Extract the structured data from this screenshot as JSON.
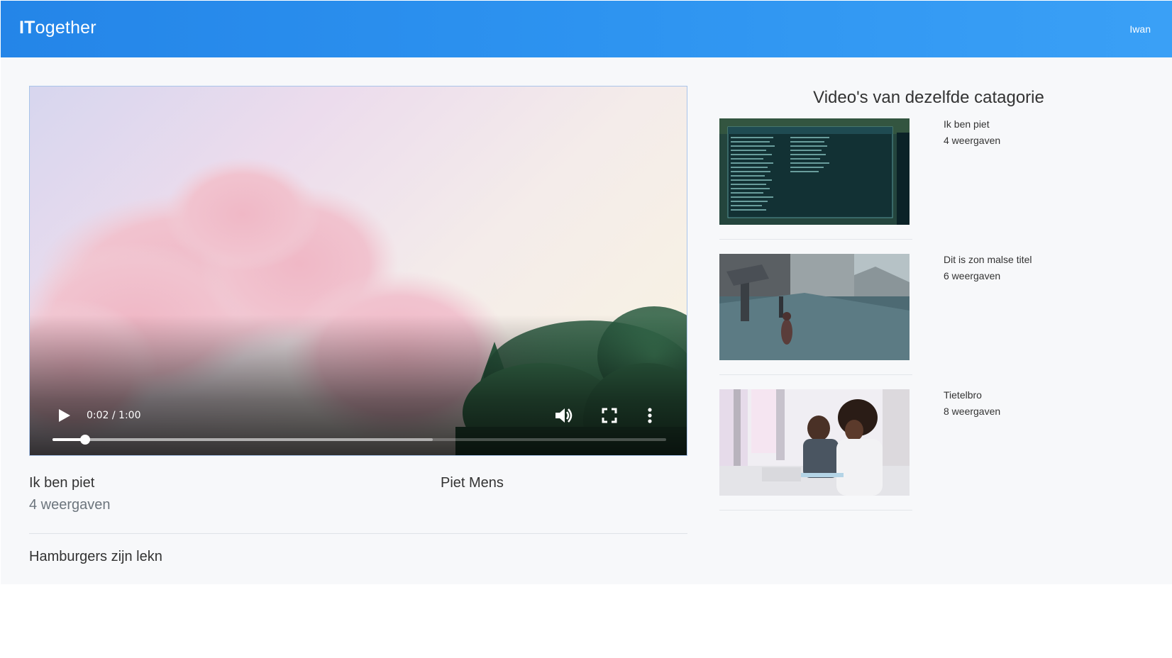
{
  "navbar": {
    "brand_bold": "IT",
    "brand_rest": "ogether",
    "user_name": "Iwan"
  },
  "player": {
    "current_time": "0:02",
    "duration": "1:00",
    "time_display": "0:02 / 1:00",
    "played_fraction": 0.053,
    "buffered_fraction": 0.62,
    "play_icon": "play-icon",
    "volume_icon": "volume-icon",
    "fullscreen_icon": "fullscreen-icon",
    "more_icon": "more-vertical-icon"
  },
  "video": {
    "title": "Ik ben piet",
    "views": "4 weergaven",
    "author": "Piet Mens",
    "description": "Hamburgers zijn lekn"
  },
  "related": {
    "heading": "Video's van dezelfde catagorie",
    "items": [
      {
        "title": "Ik ben piet",
        "views": "4 weergaven"
      },
      {
        "title": "Dit is zon malse titel",
        "views": "6 weergaven"
      },
      {
        "title": "Tietelbro",
        "views": "8 weergaven"
      }
    ]
  },
  "colors": {
    "navbar": "#2d93f0",
    "page_background": "#f7f8fa"
  }
}
